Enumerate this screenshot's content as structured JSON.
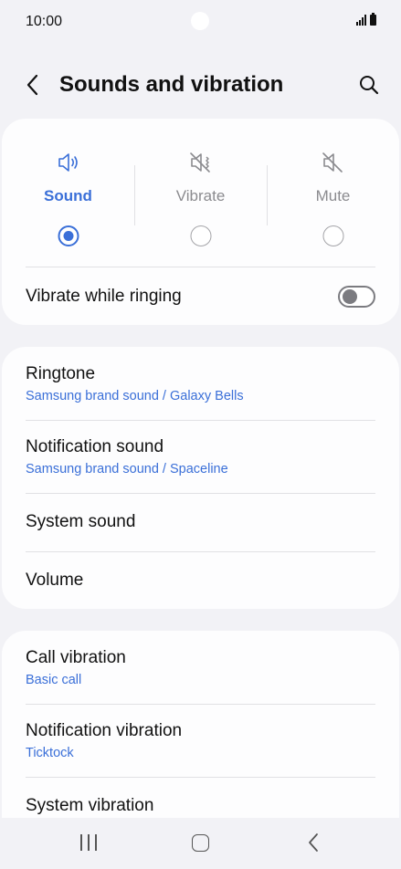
{
  "status_bar": {
    "time": "10:00"
  },
  "header": {
    "title": "Sounds and vibration",
    "back_icon": "chevron-left-icon",
    "search_icon": "search-icon"
  },
  "sound_mode": {
    "options": [
      {
        "label": "Sound",
        "icon": "speaker-icon",
        "selected": true
      },
      {
        "label": "Vibrate",
        "icon": "vibrate-icon",
        "selected": false
      },
      {
        "label": "Mute",
        "icon": "mute-icon",
        "selected": false
      }
    ]
  },
  "vibrate_while_ringing": {
    "label": "Vibrate while ringing",
    "enabled": false
  },
  "sound_settings": [
    {
      "title": "Ringtone",
      "subtitle": "Samsung brand sound / Galaxy Bells"
    },
    {
      "title": "Notification sound",
      "subtitle": "Samsung brand sound / Spaceline"
    },
    {
      "title": "System sound",
      "subtitle": ""
    },
    {
      "title": "Volume",
      "subtitle": ""
    }
  ],
  "vibration_settings": [
    {
      "title": "Call vibration",
      "subtitle": "Basic call"
    },
    {
      "title": "Notification vibration",
      "subtitle": "Ticktock"
    },
    {
      "title": "System vibration",
      "subtitle": ""
    }
  ],
  "colors": {
    "accent": "#3a6fd8",
    "background": "#f2f2f6",
    "card": "#fdfdfe"
  },
  "nav_bar": {
    "recents_icon": "recents-icon",
    "home_icon": "home-icon",
    "back_icon": "back-icon"
  }
}
